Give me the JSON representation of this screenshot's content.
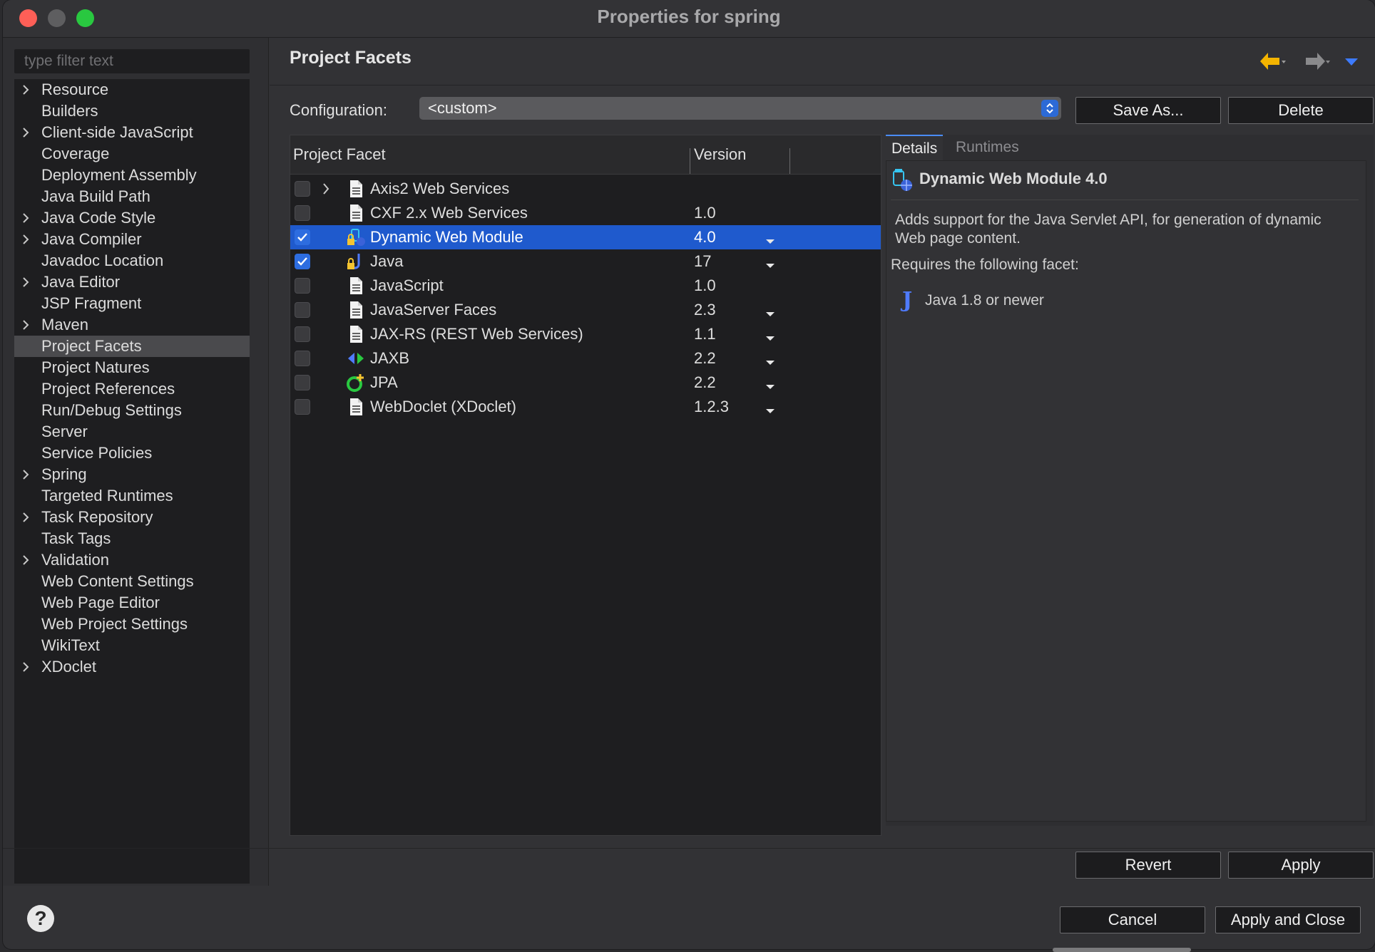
{
  "window": {
    "title": "Properties for spring"
  },
  "filter": {
    "placeholder": "type filter text",
    "value": ""
  },
  "tree": {
    "items": [
      {
        "label": "Resource",
        "expandable": true
      },
      {
        "label": "Builders",
        "expandable": false
      },
      {
        "label": "Client-side JavaScript",
        "expandable": true
      },
      {
        "label": "Coverage",
        "expandable": false
      },
      {
        "label": "Deployment Assembly",
        "expandable": false
      },
      {
        "label": "Java Build Path",
        "expandable": false
      },
      {
        "label": "Java Code Style",
        "expandable": true
      },
      {
        "label": "Java Compiler",
        "expandable": true
      },
      {
        "label": "Javadoc Location",
        "expandable": false
      },
      {
        "label": "Java Editor",
        "expandable": true
      },
      {
        "label": "JSP Fragment",
        "expandable": false
      },
      {
        "label": "Maven",
        "expandable": true
      },
      {
        "label": "Project Facets",
        "expandable": false,
        "selected": true
      },
      {
        "label": "Project Natures",
        "expandable": false
      },
      {
        "label": "Project References",
        "expandable": false
      },
      {
        "label": "Run/Debug Settings",
        "expandable": false
      },
      {
        "label": "Server",
        "expandable": false
      },
      {
        "label": "Service Policies",
        "expandable": false
      },
      {
        "label": "Spring",
        "expandable": true
      },
      {
        "label": "Targeted Runtimes",
        "expandable": false
      },
      {
        "label": "Task Repository",
        "expandable": true
      },
      {
        "label": "Task Tags",
        "expandable": false
      },
      {
        "label": "Validation",
        "expandable": true
      },
      {
        "label": "Web Content Settings",
        "expandable": false
      },
      {
        "label": "Web Page Editor",
        "expandable": false
      },
      {
        "label": "Web Project Settings",
        "expandable": false
      },
      {
        "label": "WikiText",
        "expandable": false
      },
      {
        "label": "XDoclet",
        "expandable": true
      }
    ]
  },
  "page": {
    "title": "Project Facets"
  },
  "config": {
    "label": "Configuration:",
    "value": "<custom>",
    "save_as": "Save As...",
    "delete": "Delete"
  },
  "table": {
    "col_facet": "Project Facet",
    "col_version": "Version",
    "rows": [
      {
        "name": "Axis2 Web Services",
        "version": "",
        "checked": false,
        "expandable": true,
        "icon": "doc-icon",
        "dropdown": false
      },
      {
        "name": "CXF 2.x Web Services",
        "version": "1.0",
        "checked": false,
        "icon": "doc-icon",
        "dropdown": false
      },
      {
        "name": "Dynamic Web Module",
        "version": "4.0",
        "checked": true,
        "icon": "web-module-lock-icon",
        "dropdown": true,
        "selected": true
      },
      {
        "name": "Java",
        "version": "17",
        "checked": true,
        "icon": "java-lock-icon",
        "dropdown": true
      },
      {
        "name": "JavaScript",
        "version": "1.0",
        "checked": false,
        "icon": "doc-icon",
        "dropdown": false
      },
      {
        "name": "JavaServer Faces",
        "version": "2.3",
        "checked": false,
        "icon": "doc-icon",
        "dropdown": true
      },
      {
        "name": "JAX-RS (REST Web Services)",
        "version": "1.1",
        "checked": false,
        "icon": "doc-icon",
        "dropdown": true
      },
      {
        "name": "JAXB",
        "version": "2.2",
        "checked": false,
        "icon": "jaxb-icon",
        "dropdown": true
      },
      {
        "name": "JPA",
        "version": "2.2",
        "checked": false,
        "icon": "jpa-icon",
        "dropdown": true
      },
      {
        "name": "WebDoclet (XDoclet)",
        "version": "1.2.3",
        "checked": false,
        "icon": "doc-icon",
        "dropdown": true
      }
    ]
  },
  "details": {
    "tab_details": "Details",
    "tab_runtimes": "Runtimes",
    "title": "Dynamic Web Module 4.0",
    "description": "Adds support for the Java Servlet API, for generation of dynamic Web page content.",
    "requires_label": "Requires the following facet:",
    "requirement": "Java 1.8 or newer",
    "requirement_icon": "J"
  },
  "buttons": {
    "revert": "Revert",
    "apply": "Apply",
    "cancel": "Cancel",
    "apply_close": "Apply and Close",
    "help": "?"
  },
  "colors": {
    "selection": "#1f5acd",
    "checkbox": "#2d6de0",
    "accent_back": "#f4b400"
  }
}
